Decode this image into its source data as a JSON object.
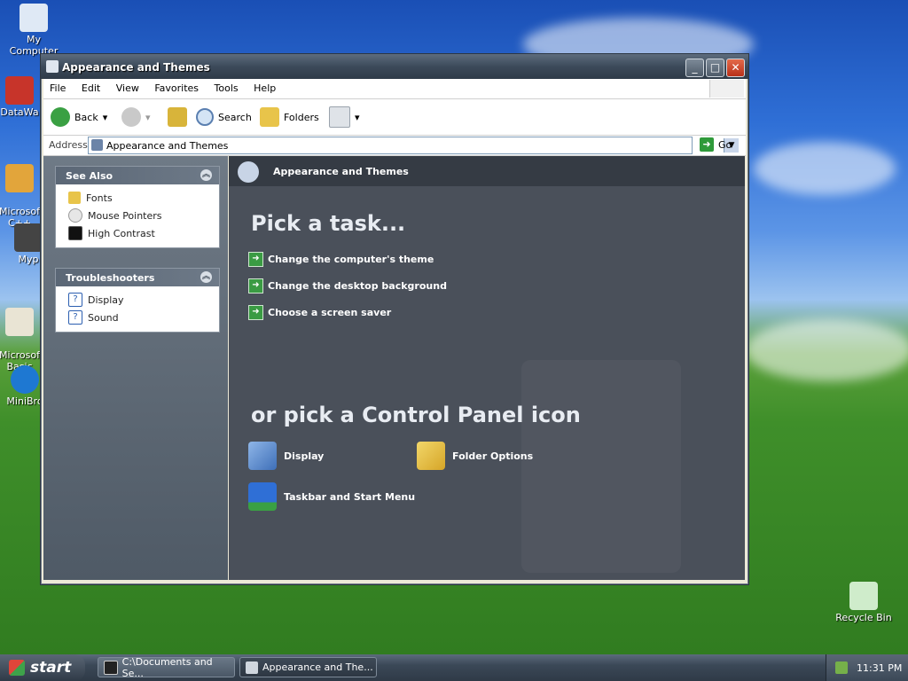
{
  "desktop": {
    "icons": [
      {
        "label": "My Computer"
      },
      {
        "label": "DataWa"
      },
      {
        "label": "Microsof\nC++"
      },
      {
        "label": "Myp"
      },
      {
        "label": "Microsof\nBasic"
      },
      {
        "label": "MiniBro"
      },
      {
        "label": "Recycle Bin"
      }
    ]
  },
  "window": {
    "title": "Appearance and Themes",
    "menu": [
      "File",
      "Edit",
      "View",
      "Favorites",
      "Tools",
      "Help"
    ],
    "toolbar": {
      "back_label": "Back",
      "search_label": "Search",
      "folders_label": "Folders"
    },
    "address": {
      "label": "Address",
      "value": "Appearance and Themes",
      "go_label": "Go"
    }
  },
  "left_pane": {
    "see_also": {
      "title": "See Also",
      "items": [
        "Fonts",
        "Mouse Pointers",
        "High Contrast"
      ]
    },
    "troubleshooters": {
      "title": "Troubleshooters",
      "items": [
        "Display",
        "Sound"
      ]
    }
  },
  "right_pane": {
    "header": "Appearance and Themes",
    "pick_task": "Pick a task...",
    "tasks": [
      "Change the computer's theme",
      "Change the desktop background",
      "Choose a screen saver"
    ],
    "pick_icon": "or pick a Control Panel icon",
    "icons": [
      {
        "label": "Display",
        "icon": "display-icon"
      },
      {
        "label": "Folder Options",
        "icon": "folder-options-icon"
      },
      {
        "label": "Taskbar and Start Menu",
        "icon": "taskbar-icon"
      }
    ]
  },
  "taskbar": {
    "start_label": "start",
    "buttons": [
      {
        "label": "C:\\Documents and Se..."
      },
      {
        "label": "Appearance and The..."
      }
    ],
    "clock": "11:31 PM"
  }
}
